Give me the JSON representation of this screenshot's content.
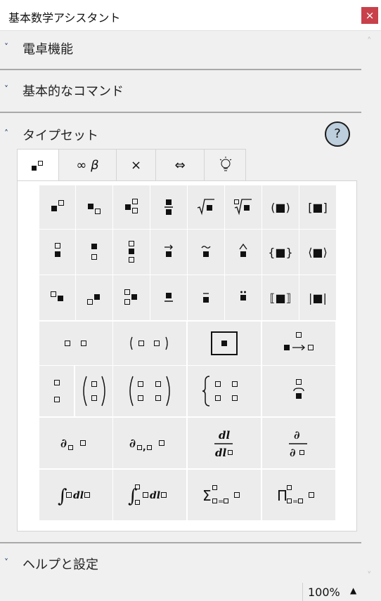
{
  "window": {
    "title": "基本数学アシスタント",
    "close_glyph": "×"
  },
  "sections": {
    "calculator": "電卓機能",
    "basic_commands": "基本的なコマンド",
    "typeset": "タイプセット",
    "help_settings": "ヘルプと設定"
  },
  "help_button": "?",
  "tabs": [
    "▪▫",
    "∞ β",
    "×",
    "⇔",
    "💡"
  ],
  "grid": {
    "row1": [
      "▪▫ superscript",
      "▪▫ subscript",
      "▪ sub-superscript",
      "fraction",
      "√▪",
      "ⁿ√▪",
      "(▪)",
      "[▪]"
    ],
    "row1_labels": [
      "",
      "",
      "",
      "",
      "",
      "",
      "(■)",
      "[■]"
    ],
    "row2_labels": [
      "",
      "",
      "",
      "",
      "",
      "",
      "{■}",
      "⟨■⟩"
    ],
    "row3_labels": [
      "",
      "",
      "",
      "",
      "",
      "",
      "⟦■⟧",
      "|■|"
    ]
  },
  "status": {
    "zoom": "100%",
    "zoom_arrow": "▲"
  }
}
